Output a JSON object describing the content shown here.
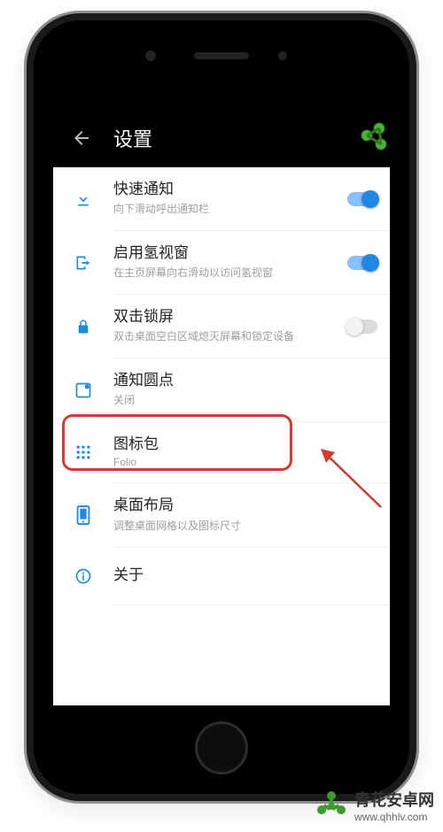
{
  "appbar": {
    "title": "设置"
  },
  "items": [
    {
      "title": "快速通知",
      "sub": "向下滑动呼出通知栏",
      "toggle": "on"
    },
    {
      "title": "启用氢视窗",
      "sub": "在主页屏幕向右滑动以访问氢视窗",
      "toggle": "on"
    },
    {
      "title": "双击锁屏",
      "sub": "双击桌面空白区域熄灭屏幕和锁定设备",
      "toggle": "off"
    },
    {
      "title": "通知圆点",
      "sub": "关闭"
    },
    {
      "title": "图标包",
      "sub": "Folio"
    },
    {
      "title": "桌面布局",
      "sub": "调整桌面网格以及图标尺寸"
    },
    {
      "title": "关于"
    }
  ],
  "accent": "#1e88e5",
  "watermark": {
    "name": "青花安卓网",
    "url": "www.qhhlv.com"
  }
}
